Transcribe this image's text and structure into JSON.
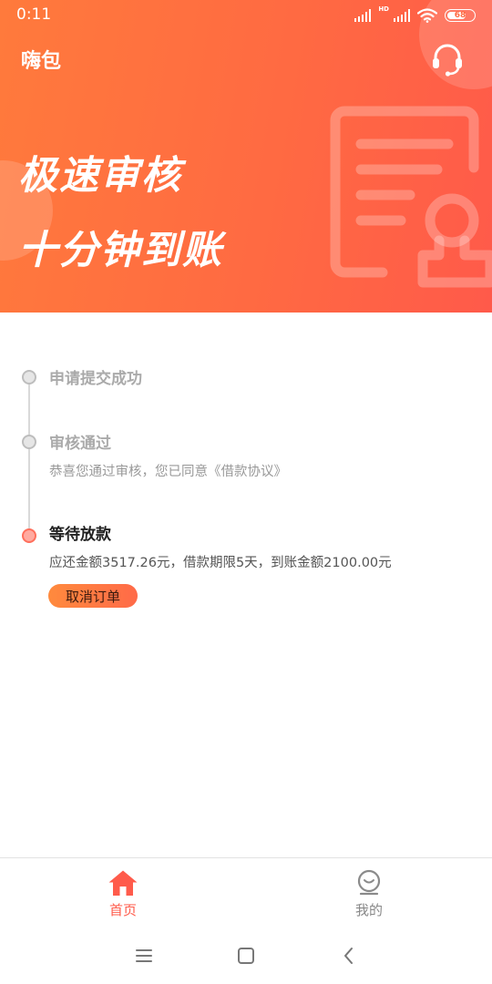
{
  "status_bar": {
    "time": "0:11",
    "hd_label": "HD",
    "battery": "68"
  },
  "header": {
    "app_title": "嗨包",
    "support_icon": "headset-icon",
    "slogan_line1": "极速审核",
    "slogan_line2": "十分钟到账",
    "illustration_icon": "document-stamp-icon"
  },
  "timeline": {
    "steps": [
      {
        "title": "申请提交成功",
        "desc": "",
        "state": "done"
      },
      {
        "title": "审核通过",
        "desc": "恭喜您通过审核，您已同意《借款协议》",
        "state": "done"
      },
      {
        "title": "等待放款",
        "desc": "应还金额3517.26元，借款期限5天，到账金额2100.00元",
        "state": "current"
      }
    ],
    "cancel_button": "取消订单"
  },
  "tabbar": {
    "items": [
      {
        "label": "首页",
        "icon": "home-icon",
        "active": true
      },
      {
        "label": "我的",
        "icon": "profile-icon",
        "active": false
      }
    ]
  },
  "system_nav": {
    "icons": [
      "menu-icon",
      "home-square-icon",
      "back-icon"
    ]
  },
  "colors": {
    "accent": "#ff5b4b",
    "banner_start": "#ff7a3c",
    "banner_end": "#ff5a4a",
    "inactive_text": "#aaaaaa"
  }
}
